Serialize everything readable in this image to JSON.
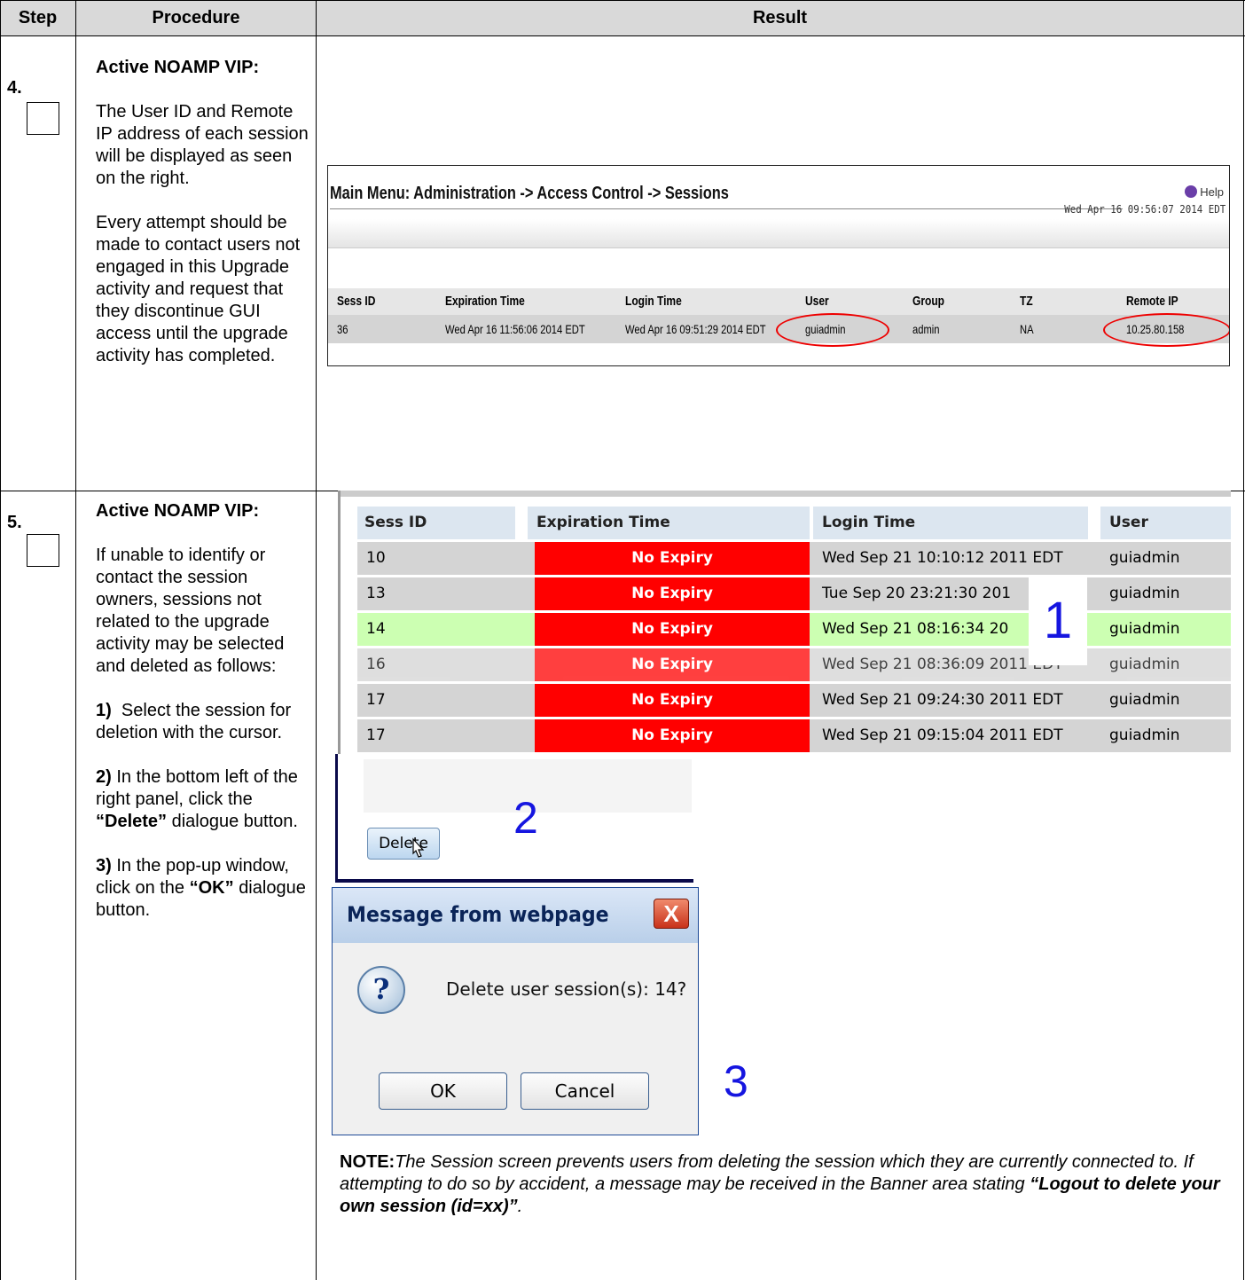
{
  "table_header": {
    "step": "Step",
    "procedure": "Procedure",
    "result": "Result"
  },
  "step4": {
    "number": "4.",
    "title": "Active NOAMP VIP:",
    "para1": "The User ID and Remote IP address of each session will be displayed as seen on the right.",
    "para2": "Every attempt should be made to contact users not engaged in this Upgrade activity and request that they discontinue GUI access until the upgrade activity has completed.",
    "screen": {
      "title": "Main Menu: Administration -> Access Control -> Sessions",
      "help": "Help",
      "timestamp": "Wed Apr 16 09:56:07 2014 EDT",
      "columns": [
        "Sess ID",
        "Expiration Time",
        "Login Time",
        "User",
        "Group",
        "TZ",
        "Remote IP"
      ],
      "row": [
        "36",
        "Wed Apr 16 11:56:06 2014 EDT",
        "Wed Apr 16 09:51:29 2014 EDT",
        "guiadmin",
        "admin",
        "NA",
        "10.25.80.158"
      ]
    }
  },
  "step5": {
    "number": "5.",
    "title": "Active NOAMP VIP:",
    "intro": "If unable to identify or contact the session owners, sessions not related to the upgrade activity may be selected and deleted as follows:",
    "item1_num": "1)",
    "item1_text": "Select the session for deletion with the cursor.",
    "item2_num": "2)",
    "item2_text_a": "In the bottom left of the right panel, click the",
    "item2_bold": "“Delete”",
    "item2_text_b": "dialogue button.",
    "item3_num": "3)",
    "item3_text_a": "In the pop-up window, click on the",
    "item3_bold": "“OK”",
    "item3_text_b": "dialogue button.",
    "sessions": {
      "columns": [
        "Sess ID",
        "Expiration Time",
        "Login Time",
        "User"
      ],
      "rows": [
        {
          "id": "10",
          "exp": "No Expiry",
          "login": "Wed Sep 21 10:10:12 2011 EDT",
          "user": "guiadmin"
        },
        {
          "id": "13",
          "exp": "No Expiry",
          "login": "Tue Sep 20 23:21:30 201",
          "user": "guiadmin"
        },
        {
          "id": "14",
          "exp": "No Expiry",
          "login": "Wed Sep 21 08:16:34 20",
          "user": "guiadmin"
        },
        {
          "id": "16",
          "exp": "No Expiry",
          "login": "Wed Sep 21 08:36:09 2011 EDT",
          "user": "guiadmin"
        },
        {
          "id": "17",
          "exp": "No Expiry",
          "login": "Wed Sep 21 09:24:30 2011 EDT",
          "user": "guiadmin"
        },
        {
          "id": "17",
          "exp": "No Expiry",
          "login": "Wed Sep 21 09:15:04 2011 EDT",
          "user": "guiadmin"
        }
      ]
    },
    "marker1": "1",
    "marker2": "2",
    "marker3": "3",
    "delete_button": "Delete",
    "dialog": {
      "title": "Message from webpage",
      "close": "X",
      "icon": "?",
      "message": "Delete user session(s): 14?",
      "ok": "OK",
      "cancel": "Cancel"
    },
    "note_label": "NOTE:",
    "note_text": "The Session screen prevents users from deleting the session which they are currently connected to.  If attempting to do so by accident, a message may be received in the Banner area stating ",
    "note_quote": "“Logout to delete your own session (id=xx)”",
    "note_end": "."
  },
  "colors": {
    "no_expiry": "#ff0000",
    "selected_row": "#ccffb2",
    "marker": "#1515e0",
    "oval": "#e00000"
  }
}
